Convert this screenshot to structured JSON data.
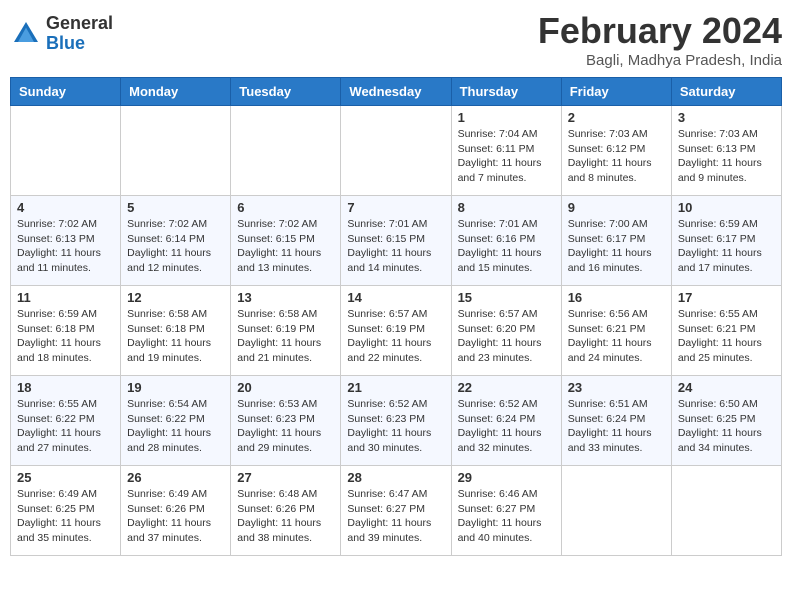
{
  "header": {
    "logo_general": "General",
    "logo_blue": "Blue",
    "month_year": "February 2024",
    "location": "Bagli, Madhya Pradesh, India"
  },
  "days_of_week": [
    "Sunday",
    "Monday",
    "Tuesday",
    "Wednesday",
    "Thursday",
    "Friday",
    "Saturday"
  ],
  "weeks": [
    [
      {
        "day": "",
        "info": ""
      },
      {
        "day": "",
        "info": ""
      },
      {
        "day": "",
        "info": ""
      },
      {
        "day": "",
        "info": ""
      },
      {
        "day": "1",
        "info": "Sunrise: 7:04 AM\nSunset: 6:11 PM\nDaylight: 11 hours\nand 7 minutes."
      },
      {
        "day": "2",
        "info": "Sunrise: 7:03 AM\nSunset: 6:12 PM\nDaylight: 11 hours\nand 8 minutes."
      },
      {
        "day": "3",
        "info": "Sunrise: 7:03 AM\nSunset: 6:13 PM\nDaylight: 11 hours\nand 9 minutes."
      }
    ],
    [
      {
        "day": "4",
        "info": "Sunrise: 7:02 AM\nSunset: 6:13 PM\nDaylight: 11 hours\nand 11 minutes."
      },
      {
        "day": "5",
        "info": "Sunrise: 7:02 AM\nSunset: 6:14 PM\nDaylight: 11 hours\nand 12 minutes."
      },
      {
        "day": "6",
        "info": "Sunrise: 7:02 AM\nSunset: 6:15 PM\nDaylight: 11 hours\nand 13 minutes."
      },
      {
        "day": "7",
        "info": "Sunrise: 7:01 AM\nSunset: 6:15 PM\nDaylight: 11 hours\nand 14 minutes."
      },
      {
        "day": "8",
        "info": "Sunrise: 7:01 AM\nSunset: 6:16 PM\nDaylight: 11 hours\nand 15 minutes."
      },
      {
        "day": "9",
        "info": "Sunrise: 7:00 AM\nSunset: 6:17 PM\nDaylight: 11 hours\nand 16 minutes."
      },
      {
        "day": "10",
        "info": "Sunrise: 6:59 AM\nSunset: 6:17 PM\nDaylight: 11 hours\nand 17 minutes."
      }
    ],
    [
      {
        "day": "11",
        "info": "Sunrise: 6:59 AM\nSunset: 6:18 PM\nDaylight: 11 hours\nand 18 minutes."
      },
      {
        "day": "12",
        "info": "Sunrise: 6:58 AM\nSunset: 6:18 PM\nDaylight: 11 hours\nand 19 minutes."
      },
      {
        "day": "13",
        "info": "Sunrise: 6:58 AM\nSunset: 6:19 PM\nDaylight: 11 hours\nand 21 minutes."
      },
      {
        "day": "14",
        "info": "Sunrise: 6:57 AM\nSunset: 6:19 PM\nDaylight: 11 hours\nand 22 minutes."
      },
      {
        "day": "15",
        "info": "Sunrise: 6:57 AM\nSunset: 6:20 PM\nDaylight: 11 hours\nand 23 minutes."
      },
      {
        "day": "16",
        "info": "Sunrise: 6:56 AM\nSunset: 6:21 PM\nDaylight: 11 hours\nand 24 minutes."
      },
      {
        "day": "17",
        "info": "Sunrise: 6:55 AM\nSunset: 6:21 PM\nDaylight: 11 hours\nand 25 minutes."
      }
    ],
    [
      {
        "day": "18",
        "info": "Sunrise: 6:55 AM\nSunset: 6:22 PM\nDaylight: 11 hours\nand 27 minutes."
      },
      {
        "day": "19",
        "info": "Sunrise: 6:54 AM\nSunset: 6:22 PM\nDaylight: 11 hours\nand 28 minutes."
      },
      {
        "day": "20",
        "info": "Sunrise: 6:53 AM\nSunset: 6:23 PM\nDaylight: 11 hours\nand 29 minutes."
      },
      {
        "day": "21",
        "info": "Sunrise: 6:52 AM\nSunset: 6:23 PM\nDaylight: 11 hours\nand 30 minutes."
      },
      {
        "day": "22",
        "info": "Sunrise: 6:52 AM\nSunset: 6:24 PM\nDaylight: 11 hours\nand 32 minutes."
      },
      {
        "day": "23",
        "info": "Sunrise: 6:51 AM\nSunset: 6:24 PM\nDaylight: 11 hours\nand 33 minutes."
      },
      {
        "day": "24",
        "info": "Sunrise: 6:50 AM\nSunset: 6:25 PM\nDaylight: 11 hours\nand 34 minutes."
      }
    ],
    [
      {
        "day": "25",
        "info": "Sunrise: 6:49 AM\nSunset: 6:25 PM\nDaylight: 11 hours\nand 35 minutes."
      },
      {
        "day": "26",
        "info": "Sunrise: 6:49 AM\nSunset: 6:26 PM\nDaylight: 11 hours\nand 37 minutes."
      },
      {
        "day": "27",
        "info": "Sunrise: 6:48 AM\nSunset: 6:26 PM\nDaylight: 11 hours\nand 38 minutes."
      },
      {
        "day": "28",
        "info": "Sunrise: 6:47 AM\nSunset: 6:27 PM\nDaylight: 11 hours\nand 39 minutes."
      },
      {
        "day": "29",
        "info": "Sunrise: 6:46 AM\nSunset: 6:27 PM\nDaylight: 11 hours\nand 40 minutes."
      },
      {
        "day": "",
        "info": ""
      },
      {
        "day": "",
        "info": ""
      }
    ]
  ]
}
